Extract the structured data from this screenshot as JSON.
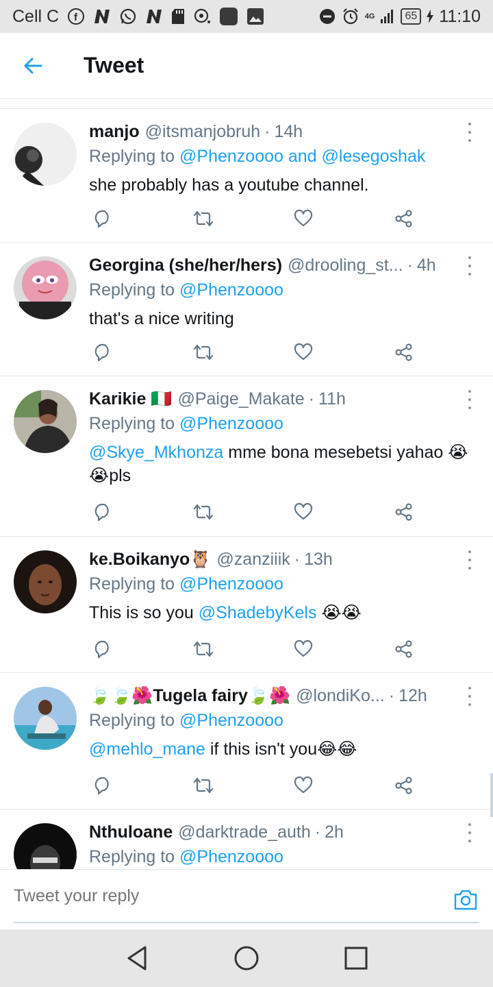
{
  "status_bar": {
    "carrier": "Cell C",
    "network_label": "4G",
    "battery": "65",
    "time": "11:10"
  },
  "header": {
    "title": "Tweet"
  },
  "tweets": [
    {
      "name": "manjo",
      "handle": "@itsmanjobruh",
      "time": "14h",
      "replying_prefix": "Replying to",
      "replying_to": "@Phenzoooo and @lesegoshak",
      "text": "she probably has a youtube channel.",
      "mention": ""
    },
    {
      "name": "Georgina (she/her/hers)",
      "handle": "@drooling_st...",
      "time": "4h",
      "replying_prefix": "Replying to",
      "replying_to": "@Phenzoooo",
      "text": "that's a nice writing",
      "mention": ""
    },
    {
      "name": "Karikie 🇮🇹",
      "handle": "@Paige_Makate",
      "time": "11h",
      "replying_prefix": "Replying to",
      "replying_to": "@Phenzoooo",
      "mention": "@Skye_Mkhonza",
      "text": " mme bona mesebetsi yahao 😭😭pls"
    },
    {
      "name": "ke.Boikanyo🦉",
      "handle": "@zanziiik",
      "time": "13h",
      "replying_prefix": "Replying to",
      "replying_to": "@Phenzoooo",
      "text_before": "This is so you ",
      "mention": "@ShadebyKels",
      "text": " 😭😭"
    },
    {
      "name": "🍃🍃🌺Tugela fairy🍃🌺",
      "handle": "@londiKo...",
      "time": "12h",
      "replying_prefix": "Replying to",
      "replying_to": "@Phenzoooo",
      "mention": "@mehlo_mane",
      "text": " if this isn't you😂😂"
    },
    {
      "name": "Nthuloane",
      "handle": "@darktrade_auth",
      "time": "2h",
      "replying_prefix": "Replying to",
      "replying_to": "@Phenzoooo"
    }
  ],
  "composer": {
    "placeholder": "Tweet your reply"
  },
  "icons": {
    "back": "arrow-left-icon",
    "reply": "reply-icon",
    "retweet": "retweet-icon",
    "like": "heart-icon",
    "share": "share-icon",
    "camera": "camera-icon"
  },
  "colors": {
    "accent": "#1da1f2",
    "secondary_text": "#657786",
    "divider": "#e1e8ed"
  }
}
